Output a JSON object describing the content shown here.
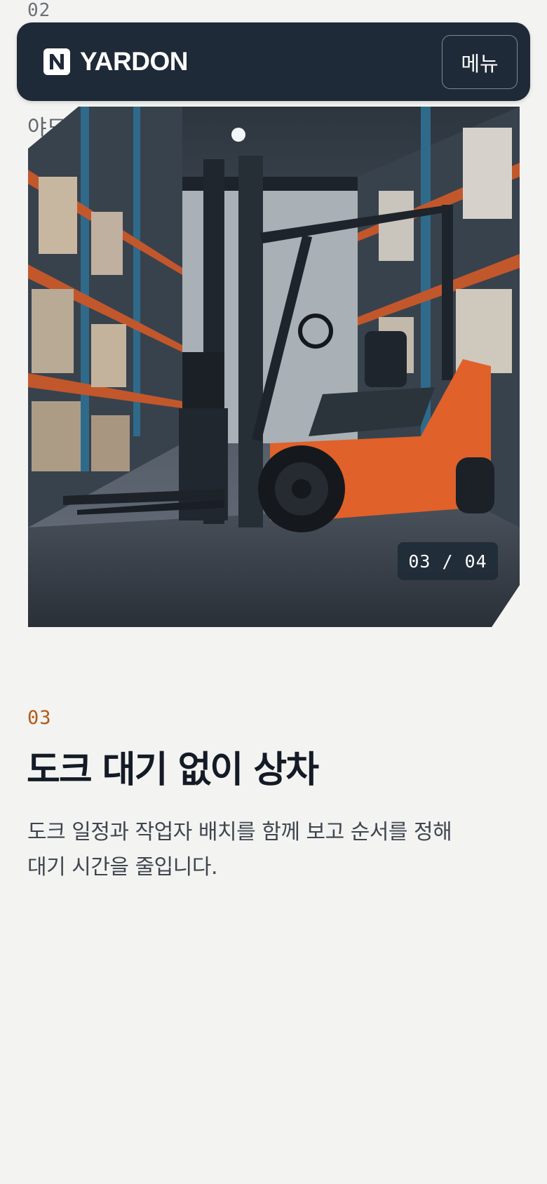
{
  "prev_slide": {
    "number": "02",
    "title_fragment": "야드"
  },
  "header": {
    "brand": "YARDON",
    "logo_icon": "n-logo-icon",
    "menu_label": "메뉴"
  },
  "slide": {
    "image_subject": "orange forklift in warehouse aisle",
    "counter": "03 / 04"
  },
  "section": {
    "number": "03",
    "title": "도크 대기 없이 상차",
    "description": "도크 일정과 작업자 배치를 함께 보고 순서를 정해 대기 시간을 줄입니다."
  },
  "colors": {
    "background": "#f3f3f1",
    "header": "#1f2a38",
    "accent": "#b35a18",
    "title": "#141b26"
  }
}
